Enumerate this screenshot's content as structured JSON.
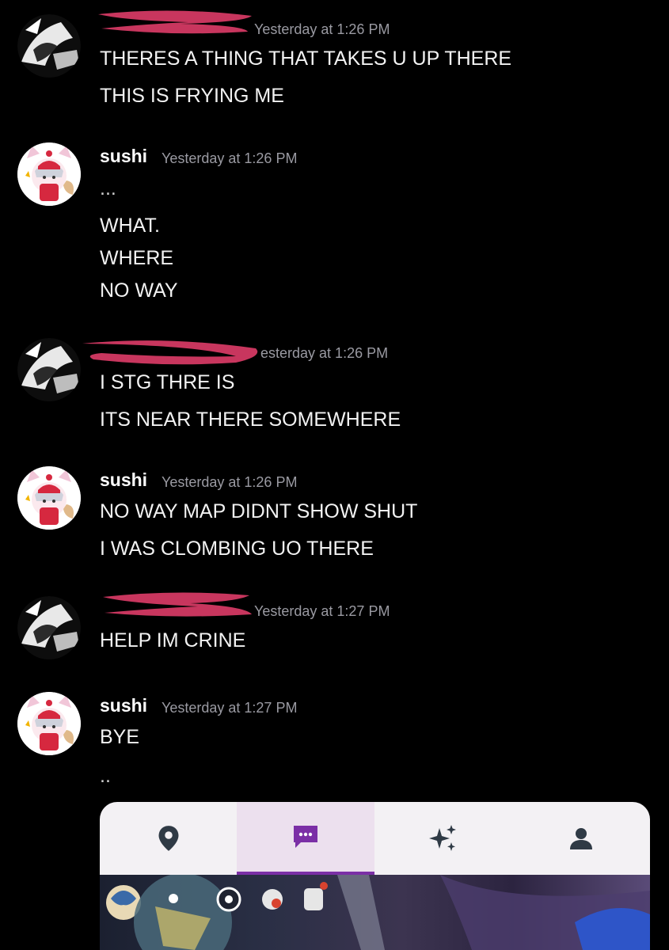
{
  "messages": [
    {
      "user": "",
      "time": "Yesterday at 1:26 PM",
      "lines": [
        "THERES A THING THAT TAKES U UP THERE",
        "THIS IS FRYING ME"
      ]
    },
    {
      "user": "sushi",
      "time": "Yesterday at 1:26 PM",
      "lines": [
        "...",
        "WHAT.",
        "WHERE",
        "NO WAY"
      ]
    },
    {
      "user": "",
      "time": "esterday at 1:26 PM",
      "lines": [
        "I STG THRE IS",
        "ITS NEAR THERE SOMEWHERE"
      ]
    },
    {
      "user": "sushi",
      "time": "Yesterday at 1:26 PM",
      "lines": [
        "NO WAY MAP DIDNT SHOW SHUT",
        "I WAS CLOMBING UO THERE"
      ]
    },
    {
      "user": "",
      "time": "Yesterday at 1:27 PM",
      "lines": [
        "HELP IM CRINE"
      ]
    },
    {
      "user": "sushi",
      "time": "Yesterday at 1:27 PM",
      "lines": [
        "BYE",
        ".."
      ]
    }
  ],
  "attachment": {
    "nav": [
      {
        "icon": "map-pin-icon",
        "active": false
      },
      {
        "icon": "chat-bubble-icon",
        "active": true
      },
      {
        "icon": "sparkles-icon",
        "active": false
      },
      {
        "icon": "person-icon",
        "active": false
      }
    ],
    "colors": {
      "active": "#7b2fa6",
      "icon": "#2f3a45"
    }
  },
  "colors": {
    "background": "#000000",
    "timestamp": "#9a9aa2",
    "redaction": "#c8365e"
  }
}
